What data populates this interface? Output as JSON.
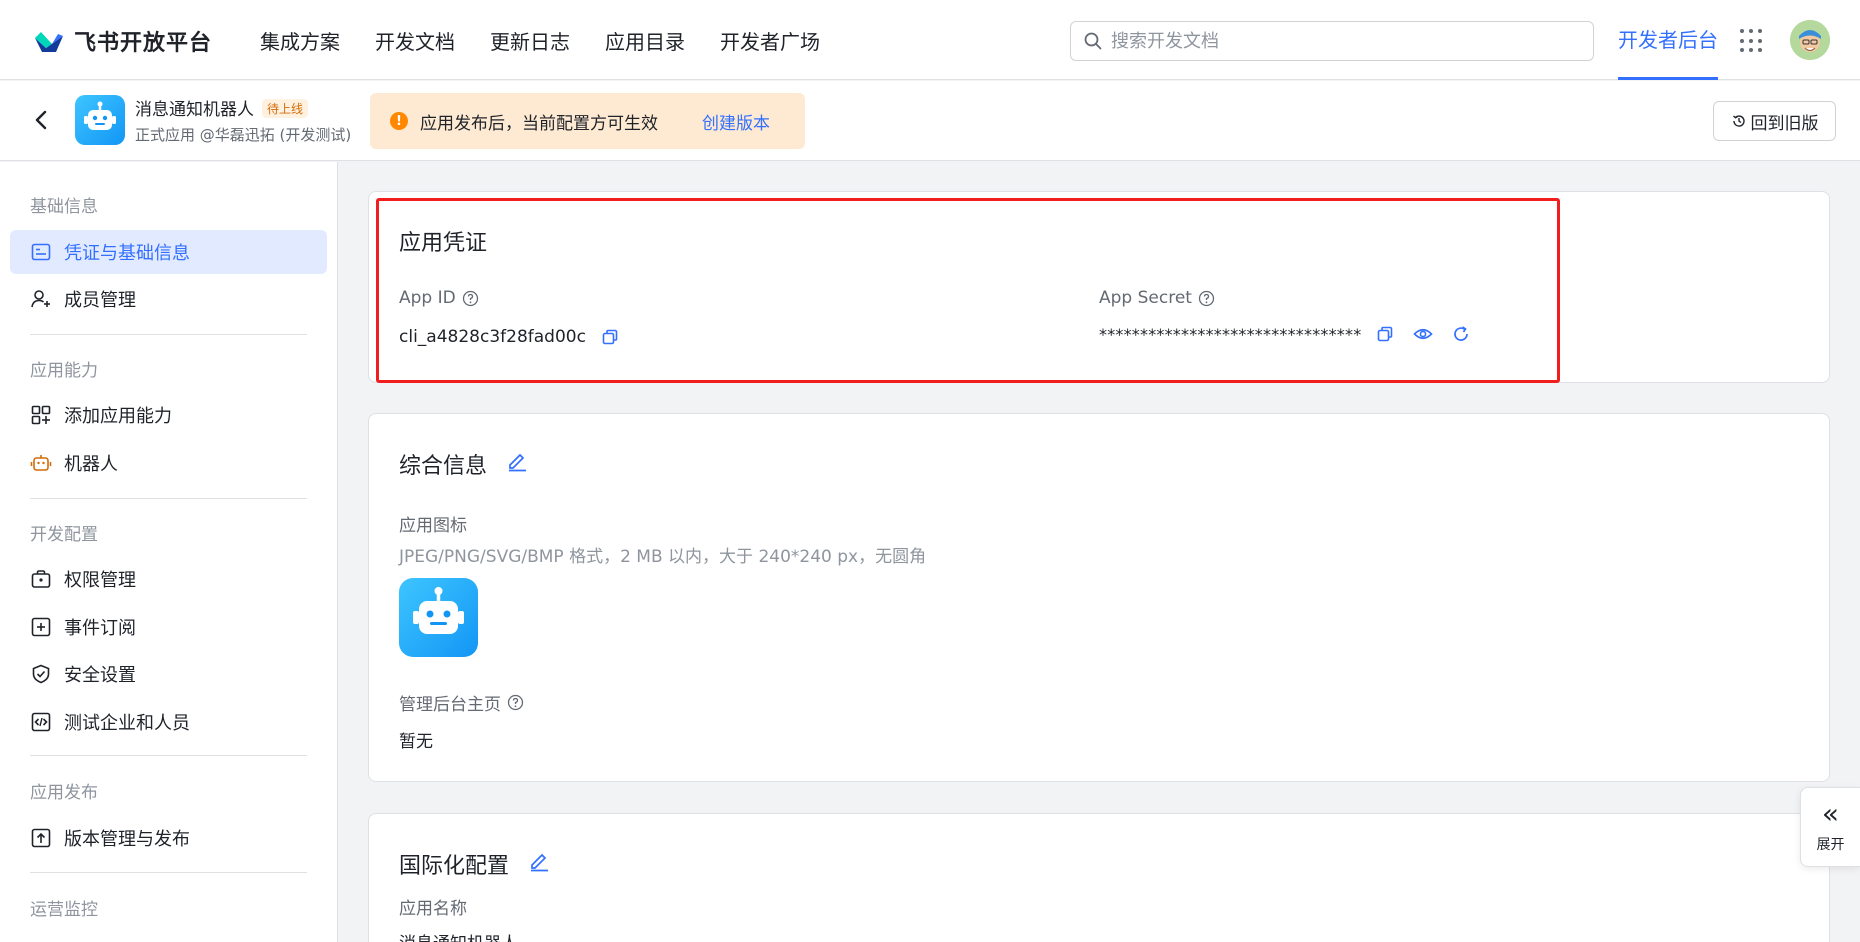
{
  "topnav": {
    "brand": "飞书开放平台",
    "links": [
      "集成方案",
      "开发文档",
      "更新日志",
      "应用目录",
      "开发者广场"
    ],
    "search_placeholder": "搜索开发文档",
    "dev_console": "开发者后台",
    "accent": "#3370ff"
  },
  "appbar": {
    "app_name": "消息通知机器人",
    "status_badge": "待上线",
    "app_sub": "正式应用 @华磊迅拓 (开发测试)",
    "notice_text": "应用发布后，当前配置方可生效",
    "notice_link": "创建版本",
    "old_version_button": "回到旧版"
  },
  "sidebar": {
    "groups": [
      {
        "title": "基础信息",
        "items": [
          {
            "label": "凭证与基础信息",
            "icon": "credential-icon",
            "active": true
          },
          {
            "label": "成员管理",
            "icon": "member-icon"
          }
        ]
      },
      {
        "title": "应用能力",
        "items": [
          {
            "label": "添加应用能力",
            "icon": "add-capability-icon"
          },
          {
            "label": "机器人",
            "icon": "robot-icon"
          }
        ]
      },
      {
        "title": "开发配置",
        "items": [
          {
            "label": "权限管理",
            "icon": "permission-icon"
          },
          {
            "label": "事件订阅",
            "icon": "event-icon"
          },
          {
            "label": "安全设置",
            "icon": "shield-icon"
          },
          {
            "label": "测试企业和人员",
            "icon": "code-icon"
          }
        ]
      },
      {
        "title": "应用发布",
        "items": [
          {
            "label": "版本管理与发布",
            "icon": "upload-icon"
          }
        ]
      },
      {
        "title": "运营监控",
        "items": []
      }
    ]
  },
  "credentials": {
    "title": "应用凭证",
    "app_id_label": "App ID",
    "app_id_value": "cli_a4828c3f28fad00c",
    "app_secret_label": "App Secret",
    "app_secret_value": "********************************"
  },
  "general": {
    "title": "综合信息",
    "icon_label": "应用图标",
    "icon_hint": "JPEG/PNG/SVG/BMP 格式，2 MB 以内，大于 240*240 px，无圆角",
    "admin_home_label": "管理后台主页",
    "admin_home_value": "暂无"
  },
  "i18n": {
    "title": "国际化配置",
    "app_name_label": "应用名称",
    "app_name_value": "消息通知机器人"
  },
  "expand_button": {
    "chevron": "«",
    "label": "展开"
  },
  "colors": {
    "highlight_border": "#f21d1d",
    "notice_bg": "#feead2",
    "warning": "#ff8800"
  }
}
